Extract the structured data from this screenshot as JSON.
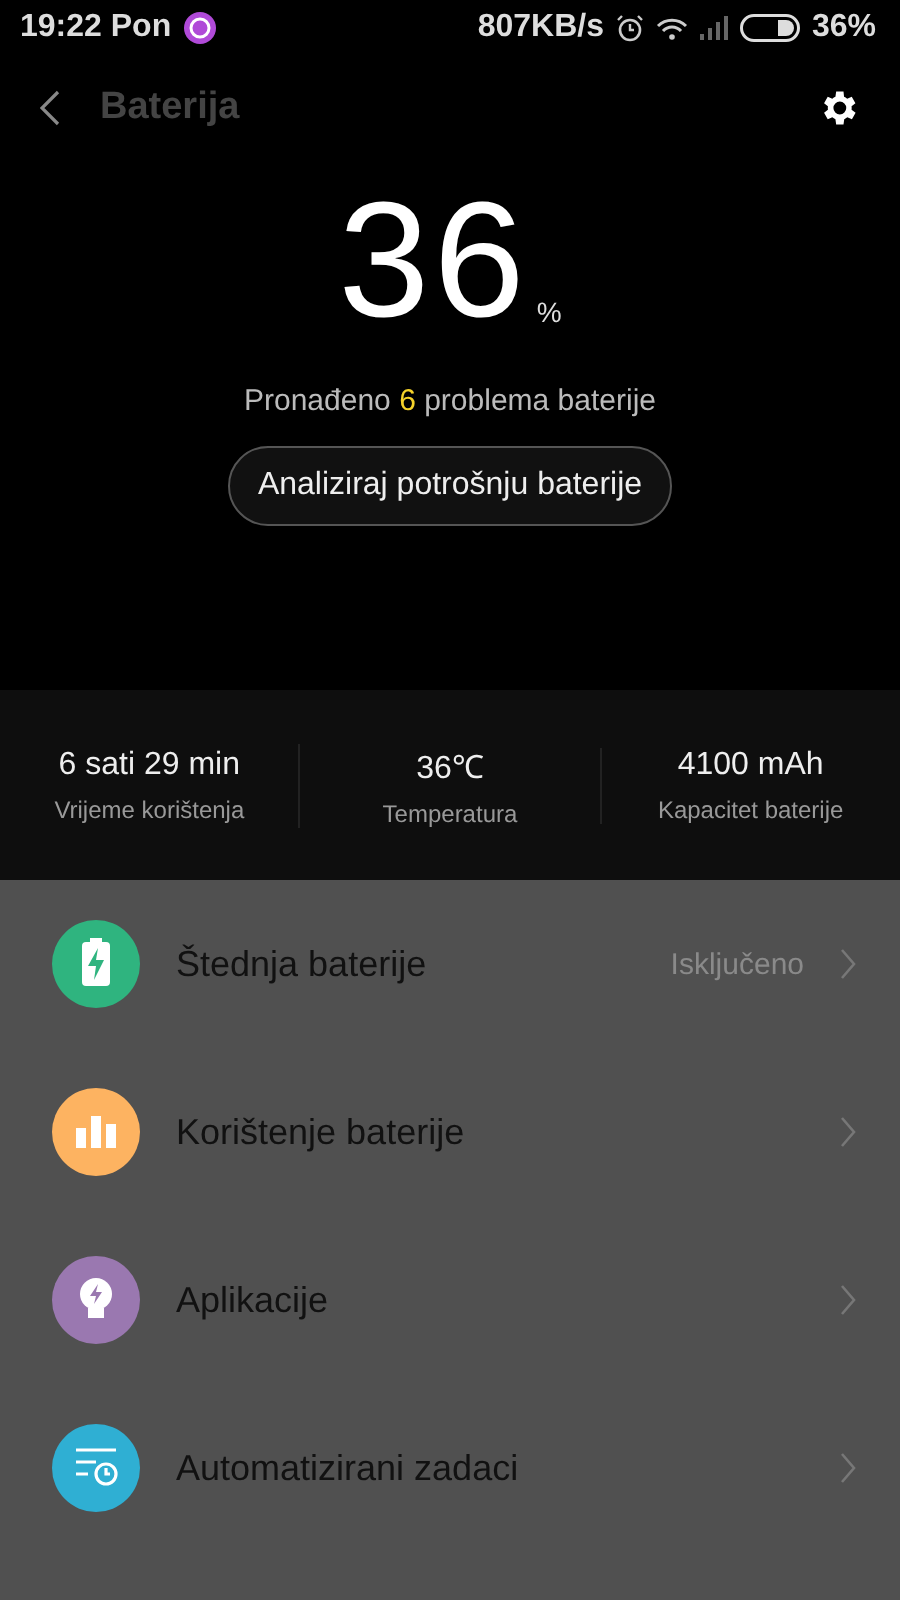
{
  "status_bar": {
    "time": "19:22 Pon",
    "speed": "807KB/s",
    "battery": "36%"
  },
  "header": {
    "title": "Baterija"
  },
  "battery": {
    "percent": "36",
    "unit": "%",
    "problems_before": "Pronađeno",
    "problems_count": "6",
    "problems_after": "problema baterije",
    "analyze_button": "Analiziraj potrošnju baterije"
  },
  "stats": [
    {
      "value": "6 sati 29 min",
      "label": "Vrijeme korištenja"
    },
    {
      "value": "36℃",
      "label": "Temperatura"
    },
    {
      "value": "4100 mAh",
      "label": "Kapacitet baterije"
    }
  ],
  "menu": [
    {
      "kind": "saver",
      "color": "#2fb47f",
      "label": "Štednja baterije",
      "status": "Isključeno"
    },
    {
      "kind": "usage",
      "color": "#fdb361",
      "label": "Korištenje baterije"
    },
    {
      "kind": "apps",
      "color": "#9a78b0",
      "label": "Aplikacije"
    },
    {
      "kind": "tasks",
      "color": "#2fafd3",
      "label": "Automatizirani zadaci"
    }
  ]
}
